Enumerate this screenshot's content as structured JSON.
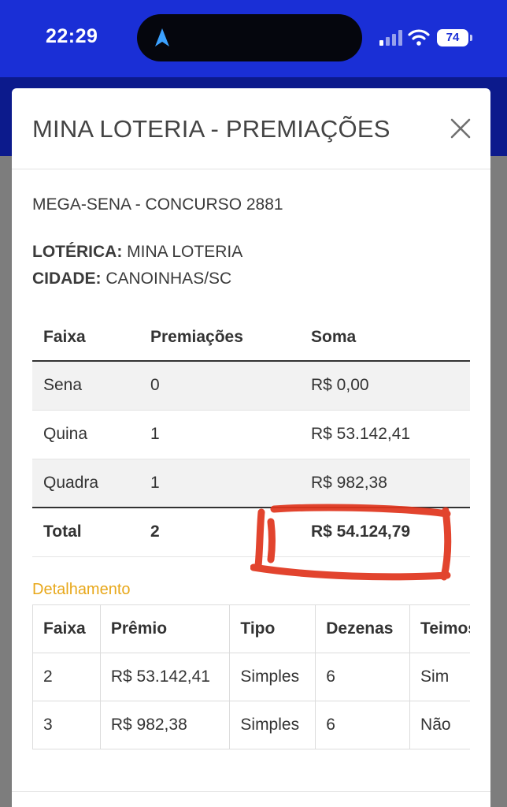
{
  "status_bar": {
    "time": "22:29",
    "battery": "74",
    "background_color": "#1a2fd6"
  },
  "modal": {
    "title": "MINA LOTERIA - PREMIAÇÕES",
    "close_icon": "close-icon",
    "draw_title": "MEGA-SENA - CONCURSO 2881",
    "loterica_label": "LOTÉRICA:",
    "loterica_value": "MINA LOTERIA",
    "cidade_label": "CIDADE:",
    "cidade_value": "CANOINHAS/SC"
  },
  "summary_table": {
    "headers": [
      "Faixa",
      "Premiações",
      "Soma"
    ],
    "rows": [
      [
        "Sena",
        "0",
        "R$ 0,00"
      ],
      [
        "Quina",
        "1",
        "R$ 53.142,41"
      ],
      [
        "Quadra",
        "1",
        "R$ 982,38"
      ]
    ],
    "total": [
      "Total",
      "2",
      "R$ 54.124,79"
    ]
  },
  "detail": {
    "label": "Detalhamento",
    "label_color": "#e8a81b",
    "headers": [
      "Faixa",
      "Prêmio",
      "Tipo",
      "Dezenas",
      "Teimosinha"
    ],
    "rows": [
      [
        "2",
        "R$ 53.142,41",
        "Simples",
        "6",
        "Sim"
      ],
      [
        "3",
        "R$ 982,38",
        "Simples",
        "6",
        "Não"
      ]
    ]
  },
  "annotation_color": "#e0341c"
}
